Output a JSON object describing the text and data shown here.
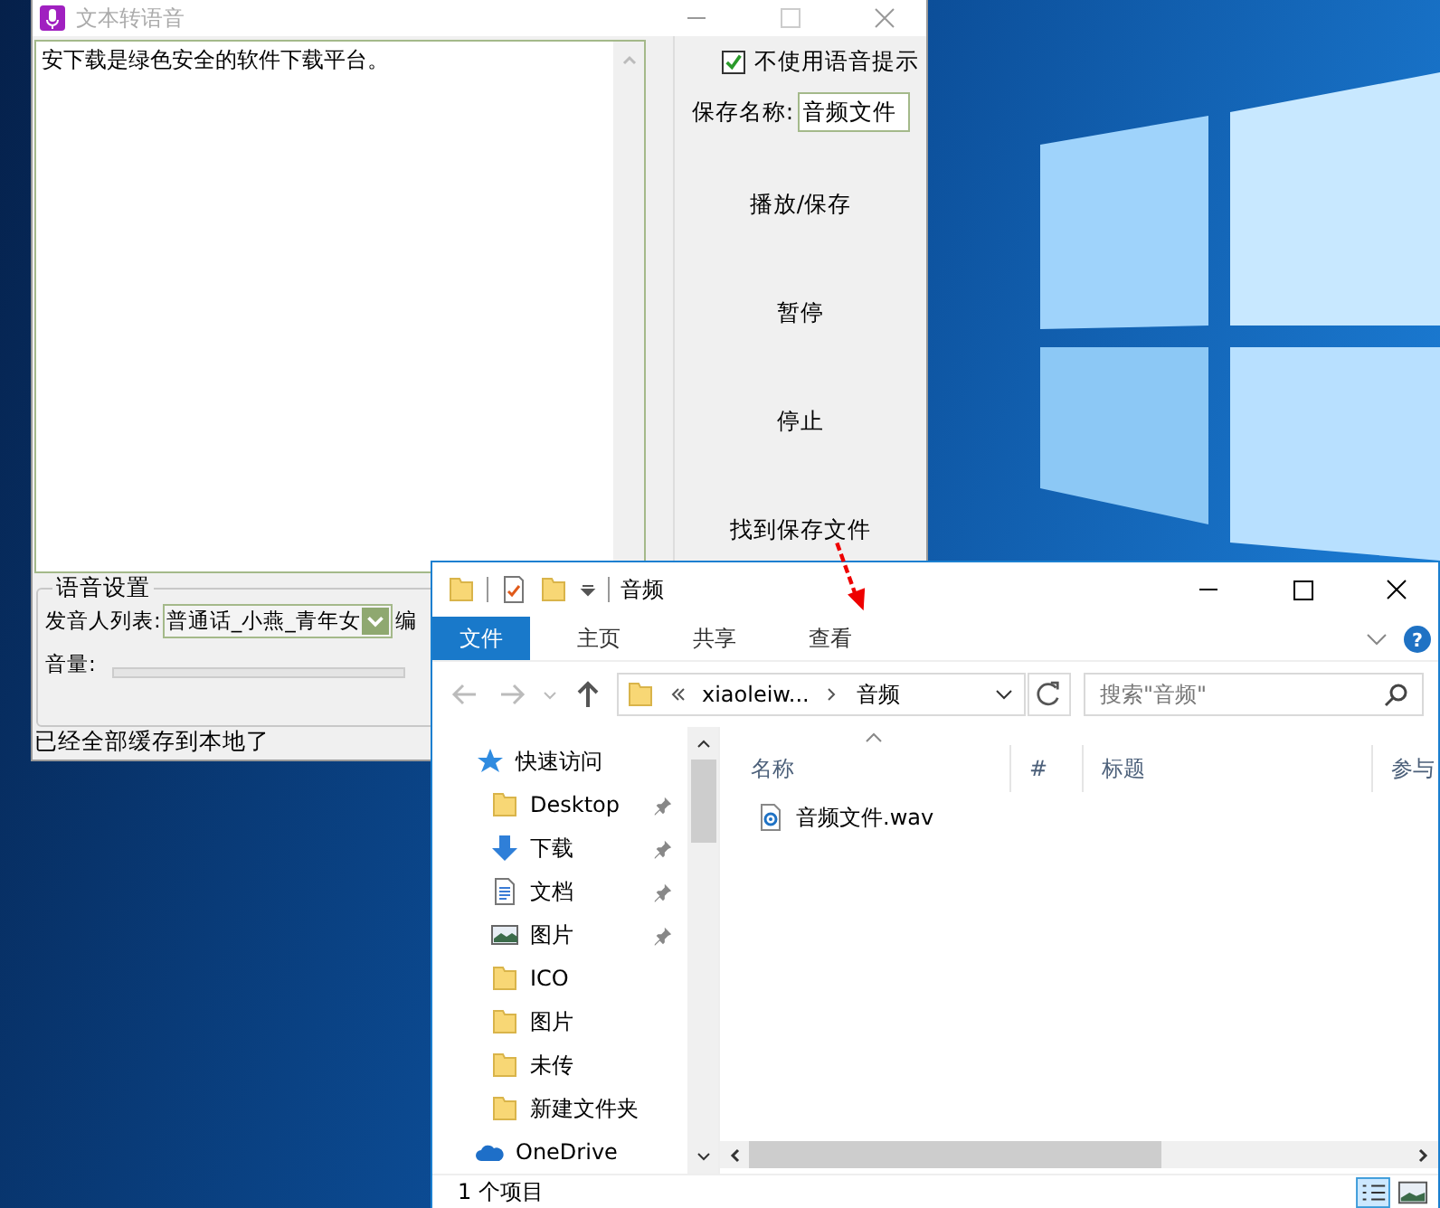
{
  "app_window": {
    "title": "文本转语音",
    "text": "安下载是绿色安全的软件下载平台。",
    "mute_prompt": {
      "label": "不使用语音提示",
      "checked": true
    },
    "save_name": {
      "label": "保存名称:",
      "value": "音频文件"
    },
    "buttons": [
      "播放/保存",
      "暂停",
      "停止",
      "找到保存文件"
    ],
    "voice_settings": {
      "title": "语音设置",
      "speaker_label": "发音人列表:",
      "speaker": "普通话_小燕_青年女",
      "column_3": "编",
      "volume_label": "音量:"
    },
    "status": "已经全部缓存到本地了"
  },
  "explorer": {
    "title": "音频",
    "ribbon_tabs": [
      {
        "label": "文件",
        "selected": true
      },
      {
        "label": "主页",
        "selected": false
      },
      {
        "label": "共享",
        "selected": false
      },
      {
        "label": "查看",
        "selected": false
      }
    ],
    "path": [
      "xiaoleiw...",
      "音频"
    ],
    "search": {
      "placeholder": "搜索\"音频\""
    },
    "help_glyph": "?",
    "nav": [
      {
        "label": "快速访问",
        "kind": "star",
        "pinned": false,
        "children": [
          {
            "label": "Desktop",
            "kind": "folder",
            "pinned": true
          },
          {
            "label": "下载",
            "kind": "download",
            "pinned": true
          },
          {
            "label": "文档",
            "kind": "document",
            "pinned": true
          },
          {
            "label": "图片",
            "kind": "picture",
            "pinned": true
          },
          {
            "label": "ICO",
            "kind": "folder",
            "pinned": false
          },
          {
            "label": "图片",
            "kind": "folder",
            "pinned": false
          },
          {
            "label": "未传",
            "kind": "folder",
            "pinned": false
          },
          {
            "label": "新建文件夹",
            "kind": "folder",
            "pinned": false
          }
        ]
      },
      {
        "label": "OneDrive",
        "kind": "cloud",
        "pinned": false
      }
    ],
    "columns": [
      "名称",
      "#",
      "标题",
      "参与"
    ],
    "files": [
      {
        "name": "音频文件.wav"
      }
    ],
    "status": "1 个项目"
  }
}
